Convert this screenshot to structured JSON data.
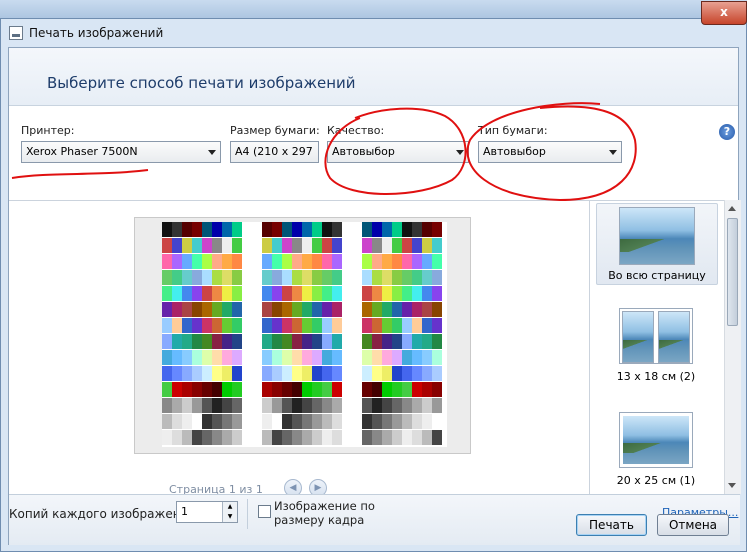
{
  "window": {
    "title": "Печать изображений",
    "close_glyph": "x"
  },
  "header": {
    "heading": "Выберите способ печати изображений"
  },
  "printer": {
    "label": "Принтер:",
    "value": "Xerox Phaser 7500N"
  },
  "paper_size": {
    "label": "Размер бумаги:",
    "value": "A4 (210 x 297"
  },
  "quality": {
    "label": "Качество:",
    "value": "Автовыбор"
  },
  "paper_type": {
    "label": "Тип бумаги:",
    "value": "Автовыбор"
  },
  "help": {
    "glyph": "?"
  },
  "preview": {
    "page_indicator": "Страница 1 из 1",
    "prev_glyph": "◀",
    "next_glyph": "▶"
  },
  "layouts": [
    {
      "label": "Во всю страницу",
      "selected": true
    },
    {
      "label": "13 x 18 см (2)",
      "selected": false
    },
    {
      "label": "20 x 25 см (1)",
      "selected": false
    }
  ],
  "footer": {
    "copies_label": "Копий каждого изображения:",
    "copies_value": "1",
    "fit_line1": "Изображение по",
    "fit_line2": "размеру кадра",
    "options_link": "Параметры...",
    "print_button": "Печать",
    "cancel_button": "Отмена"
  },
  "colors": {
    "annotation_red": "#e01010",
    "link": "#1e63b8",
    "heading": "#1e3d6b"
  }
}
